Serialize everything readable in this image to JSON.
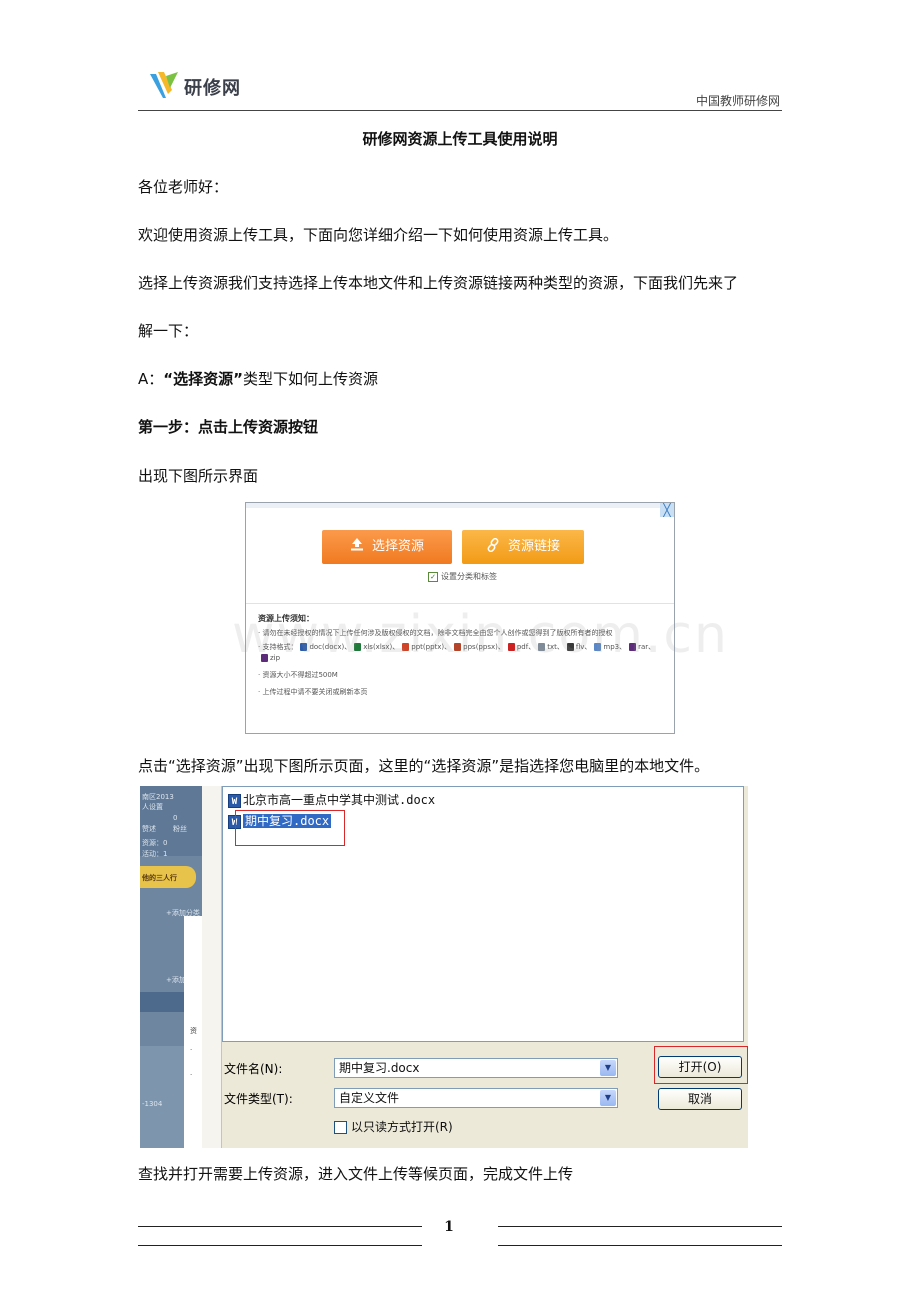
{
  "header": {
    "logo_text": "研修网",
    "org_name": "中国教师研修网"
  },
  "document": {
    "title": "研修网资源上传工具使用说明",
    "greeting": "各位老师好：",
    "intro": "欢迎使用资源上传工具，下面向您详细介绍一下如何使用资源上传工具。",
    "para1_line1": "选择上传资源我们支持选择上传本地文件和上传资源链接两种类型的资源，下面我们先来了",
    "para1_line2": "解一下：",
    "sectionA_prefix": "A：",
    "sectionA_bold": "“选择资源”",
    "sectionA_suffix": "类型下如何上传资源",
    "step1": "第一步：点击上传资源按钮",
    "figure_intro": "出现下图所示界面",
    "para2": "点击“选择资源”出现下图所示页面，这里的“选择资源”是指选择您电脑里的本地文件。",
    "para3": "查找并打开需要上传资源，进入文件上传等候页面，完成文件上传"
  },
  "upload_dialog": {
    "close_symbol": "╳",
    "btn_select": "选择资源",
    "btn_link": "资源链接",
    "checkbox_label": "设置分类和标签",
    "notes_title": "资源上传须知：",
    "note1": "· 请勿在未经授权的情况下上传任何涉及版权侵权的文档，除非文档完全由您个人创作或您得到了版权所有者的授权",
    "formats_prefix": "· 支持格式：",
    "formats": [
      "doc(docx)、",
      "xls(xlsx)、",
      "ppt(pptx)、",
      "pps(ppsx)、",
      "pdf、",
      "txt、",
      "flv、",
      "mp3、",
      "rar、",
      "zip"
    ],
    "format_colors": [
      "#2b5aa8",
      "#1f7a3a",
      "#d0442a",
      "#b4452a",
      "#cc2222",
      "#7f8b99",
      "#3a3a3a",
      "#5a87c8",
      "#5c2c7a",
      "#5c2c7a"
    ],
    "note2": "· 资源大小不得超过500M",
    "note3": "· 上传过程中请不要关闭或刷新本页"
  },
  "file_dialog": {
    "left_texts": [
      "南区2013",
      "人设置",
      "0",
      "赞述",
      "粉丝",
      "资源：0",
      "活动：1",
      "他的三人行",
      "+添加分类",
      "+添加",
      "资",
      "·",
      "·",
      "-1304"
    ],
    "files": [
      {
        "name": "北京市高一重点中学其中测试.docx",
        "selected": false
      },
      {
        "name": "期中复习.docx",
        "selected": true
      }
    ],
    "filename_label": "文件名(N):",
    "filename_value": "期中复习.docx",
    "filetype_label": "文件类型(T):",
    "filetype_value": "自定义文件",
    "readonly_label": "以只读方式打开(R)",
    "open_button": "打开(O)",
    "cancel_button": "取消"
  },
  "watermark": "www.zixin.com.cn",
  "footer": {
    "page_number": "1"
  }
}
